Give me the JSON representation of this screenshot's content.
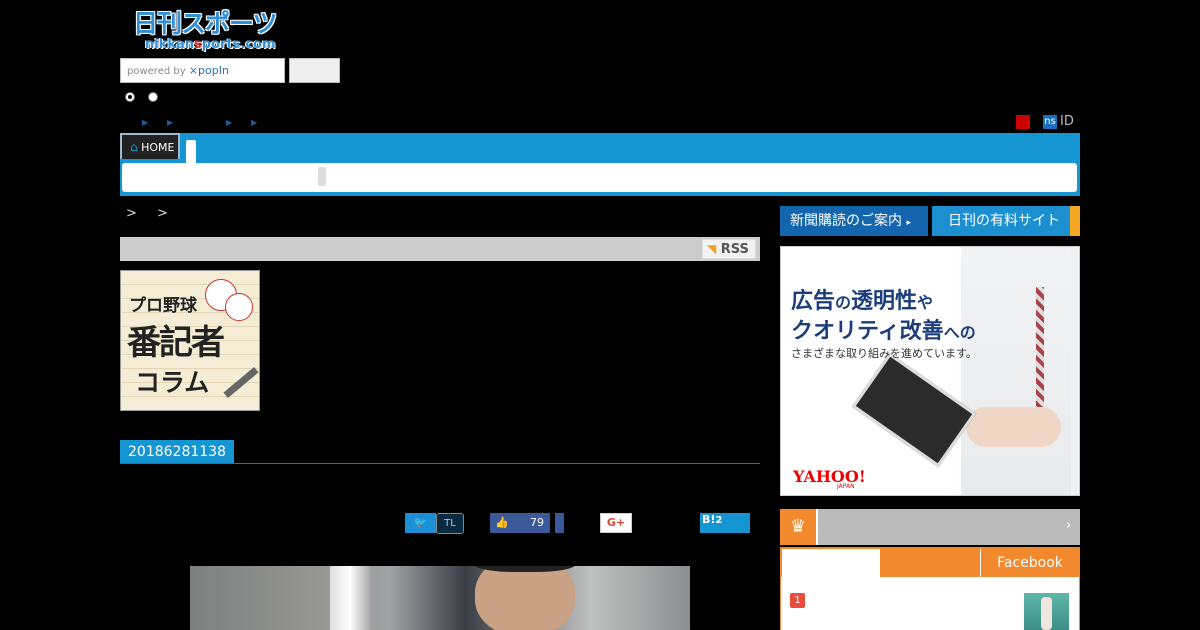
{
  "header": {
    "logo_ja": "日刊スポーツ",
    "logo_en_pre": "nikkan",
    "logo_en_mid": "s",
    "logo_en_post": "ports.com",
    "search_placeholder_prefix": "powered by ",
    "search_placeholder_brand": "⨯popIn",
    "search_button": "",
    "id_label": "ID",
    "ns_badge": "ns"
  },
  "nav": {
    "home_label": "HOME",
    "home_icon": "home-icon"
  },
  "breadcrumb": {
    "separators": ">  >"
  },
  "rss": {
    "label": "RSS",
    "icon": "rss-icon"
  },
  "column_banner": {
    "line1": "プロ野球",
    "line2": "番記者",
    "line3": "コラム"
  },
  "article": {
    "date": "20186281138"
  },
  "share": {
    "twitter_icon": "twitter-icon",
    "tl_label": "TL",
    "like_count": "79",
    "gplus_label": "G+",
    "hatena_label": "B!",
    "hatena_count": "2"
  },
  "sidebar": {
    "subscribe": "新聞購読のご案内",
    "paid_sites": "日刊の有料サイト",
    "ad": {
      "line1_a": "広告",
      "line1_b": "の",
      "line1_c": "透明性",
      "line1_d": "や",
      "line2_a": "クオリティ改善",
      "line2_b": "への",
      "line3": "さまざまな取り組みを進めています。",
      "brand": "YAHOO!",
      "brand_sub": "JAPAN"
    },
    "ranking": {
      "icon": "ranking-medal-icon",
      "arrow": "›",
      "tab_facebook": "Facebook",
      "first_rank": "1"
    }
  },
  "colors": {
    "nav_blue": "#1596d3",
    "accent_orange": "#f28a2d",
    "subscribe_blue": "#1365ad"
  }
}
